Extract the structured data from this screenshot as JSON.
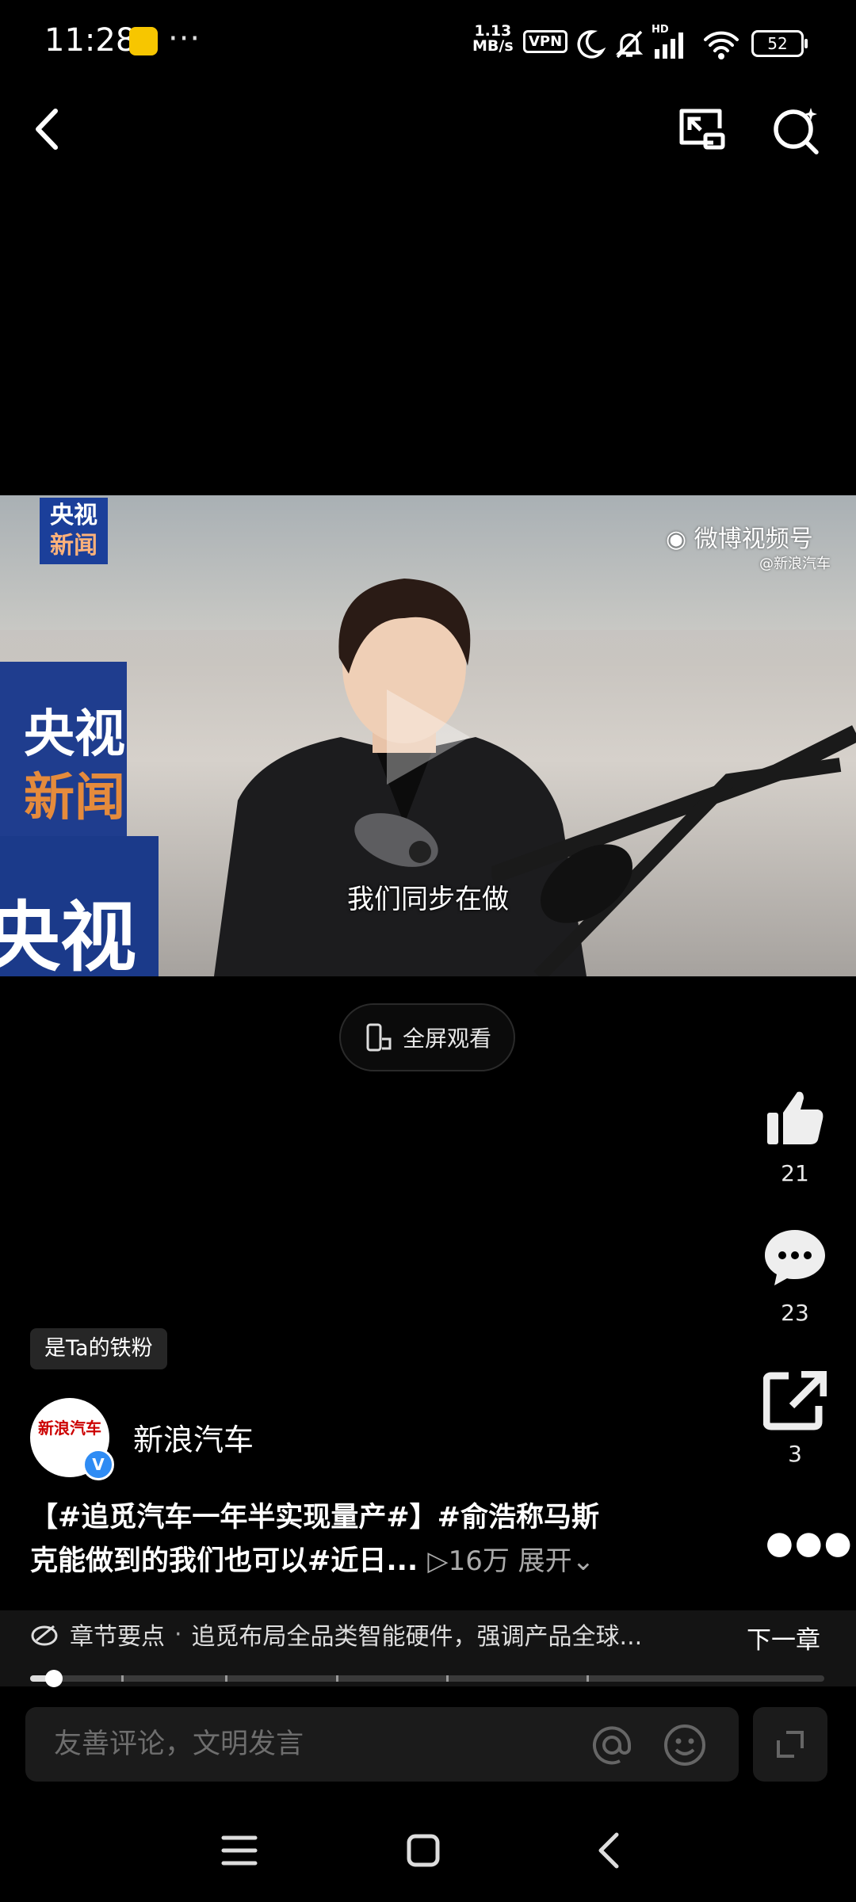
{
  "status_bar": {
    "time": "11:28",
    "net_speed_value": "1.13",
    "net_speed_unit": "MB/s",
    "vpn": "VPN",
    "hd": "HD",
    "battery": "52"
  },
  "video": {
    "caption": "我们同步在做",
    "watermark": "微博视频号",
    "watermark_sub": "@新浪汽车",
    "channel_logo_line1": "央视",
    "channel_logo_line2": "新闻",
    "backdrop_text_1": "央视",
    "backdrop_text_2": "新闻",
    "backdrop_text_3": "央视"
  },
  "fullscreen_label": "全屏观看",
  "actions": {
    "likes": "21",
    "comments": "23",
    "shares": "3"
  },
  "fan_badge": "是Ta的铁粉",
  "author": {
    "name": "新浪汽车",
    "avatar_text": "新浪汽车",
    "verified": "V"
  },
  "description": {
    "line1": "【#追觅汽车一年半实现量产#】#俞浩称马斯",
    "line2": "克能做到的我们也可以#近日...",
    "views": "16万",
    "expand": "展开"
  },
  "chapter": {
    "label": "章节要点",
    "separator": "·",
    "text": "追觅布局全品类智能硬件，强调产品全球...",
    "next": "下一章",
    "progress": 0.03
  },
  "comment": {
    "placeholder": "友善评论，文明发言"
  },
  "colors": {
    "background": "#000000",
    "accent_verified": "#2f8cf4"
  }
}
